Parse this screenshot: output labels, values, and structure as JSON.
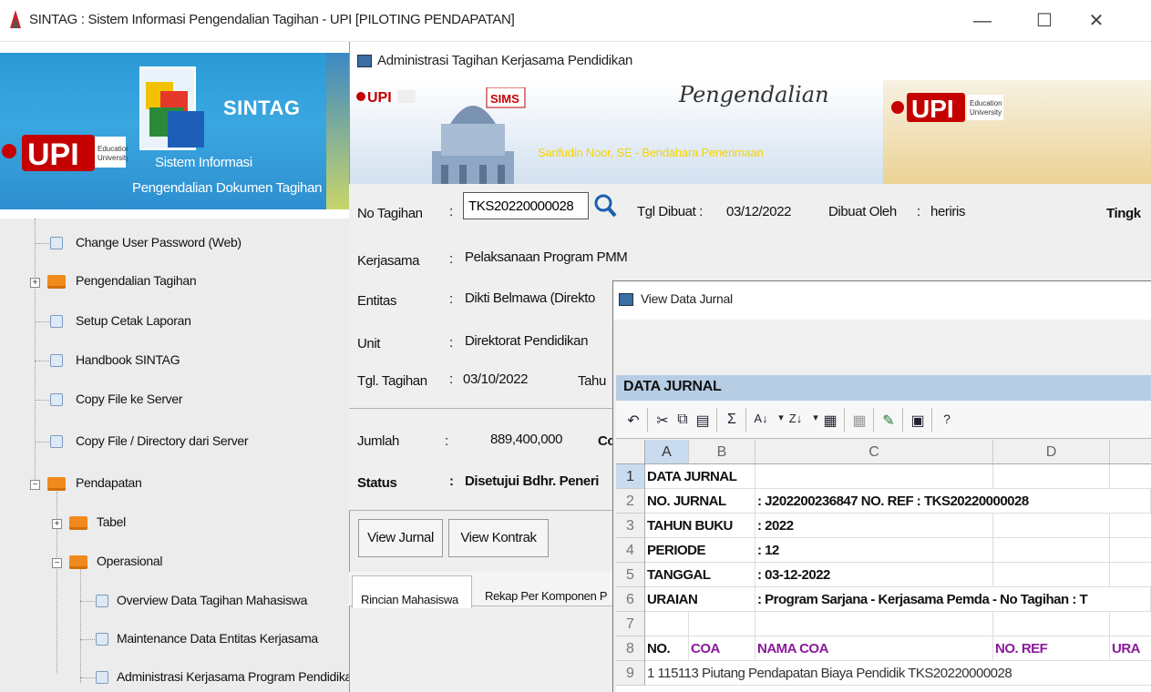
{
  "app": {
    "title": "SINTAG : Sistem Informasi Pengendalian Tagihan - UPI [PILOTING PENDAPATAN]",
    "minimize": "—",
    "maximize": "☐",
    "close": "✕"
  },
  "left_banner": {
    "logo_text": "UPI",
    "sintag": "SINTAG",
    "line1": "Sistem Informasi",
    "line2": "Pengendalian Dokumen Tagihan"
  },
  "tree": {
    "items": [
      {
        "label": "Change User Password (Web)"
      },
      {
        "label": "Pengendalian Tagihan"
      },
      {
        "label": "Setup Cetak Laporan"
      },
      {
        "label": "Handbook SINTAG"
      },
      {
        "label": "Copy File ke Server"
      },
      {
        "label": "Copy File / Directory dari Server"
      },
      {
        "label": "Pendapatan"
      },
      {
        "label": "Tabel"
      },
      {
        "label": "Operasional"
      },
      {
        "label": "Overview Data Tagihan Mahasiswa"
      },
      {
        "label": "Maintenance Data Entitas Kerjasama"
      },
      {
        "label": "Administrasi Kerjasama Program Pendidikan"
      }
    ]
  },
  "admin": {
    "title": "Administrasi Tagihan Kerjasama Pendidikan",
    "banner_right_title": "Pengendalian",
    "bendahara": "Sarifudin Noor, SE - Bendahara Penerimaan",
    "sims": "SIMS",
    "no_tagihan_label": "No Tagihan",
    "no_tagihan_value": "TKS20220000028",
    "tgl_dibuat_label": "Tgl Dibuat :",
    "tgl_dibuat_value": "03/12/2022",
    "dibuat_oleh_label": "Dibuat Oleh",
    "dibuat_oleh_value": "heriris",
    "tingkat_label": "Tingk",
    "kerjasama_label": "Kerjasama",
    "kerjasama_value": "Pelaksanaan Program PMM",
    "entitas_label": "Entitas",
    "entitas_value": "Dikti Belmawa (Direkto",
    "unit_label": "Unit",
    "unit_value": "Direktorat Pendidikan",
    "tgl_tagihan_label": "Tgl. Tagihan",
    "tgl_tagihan_value": "03/10/2022",
    "tahun_label": "Tahu",
    "jumlah_label": "Jumlah",
    "jumlah_value": "889,400,000",
    "co_label": "Co",
    "status_label": "Status",
    "status_value": "Disetujui Bdhr. Peneri",
    "view_jurnal": "View Jurnal",
    "view_kontrak": "View Kontrak",
    "tab1": "Rincian Mahasiswa",
    "tab2": "Rekap Per Komponen P"
  },
  "view_jurnal": {
    "title": "View Data Jurnal",
    "header": "DATA JURNAL",
    "columns": [
      "A",
      "B",
      "C",
      "D",
      ""
    ],
    "rows": [
      {
        "n": "1",
        "a": "DATA JURNAL",
        "c": "",
        "d": "",
        "e": ""
      },
      {
        "n": "2",
        "a": "NO. JURNAL",
        "c": ": J202200236847     NO. REF : TKS20220000028",
        "d": "",
        "e": ""
      },
      {
        "n": "3",
        "a": "TAHUN BUKU",
        "c": ": 2022",
        "d": "",
        "e": ""
      },
      {
        "n": "4",
        "a": "PERIODE",
        "c": ": 12",
        "d": "",
        "e": ""
      },
      {
        "n": "5",
        "a": "TANGGAL",
        "c": ": 03-12-2022",
        "d": "",
        "e": ""
      },
      {
        "n": "6",
        "a": "URAIAN",
        "c": ": Program Sarjana - Kerjasama Pemda - No Tagihan : T",
        "d": "",
        "e": ""
      },
      {
        "n": "7",
        "a": "",
        "c": "",
        "d": "",
        "e": ""
      },
      {
        "n": "8",
        "a": "NO.",
        "b": "COA",
        "c": "NAMA COA",
        "d": "NO. REF",
        "e": "URA"
      }
    ],
    "row9_partial": "1  115113   Piutang Pendapatan Biaya Pendidik  TKS20220000028"
  },
  "colors": {
    "banner_blue": "#2a9ad6",
    "grid_header_blue": "#b6cde4",
    "accent_purple": "#8a1a9a",
    "folder_orange": "#f08a1c"
  }
}
